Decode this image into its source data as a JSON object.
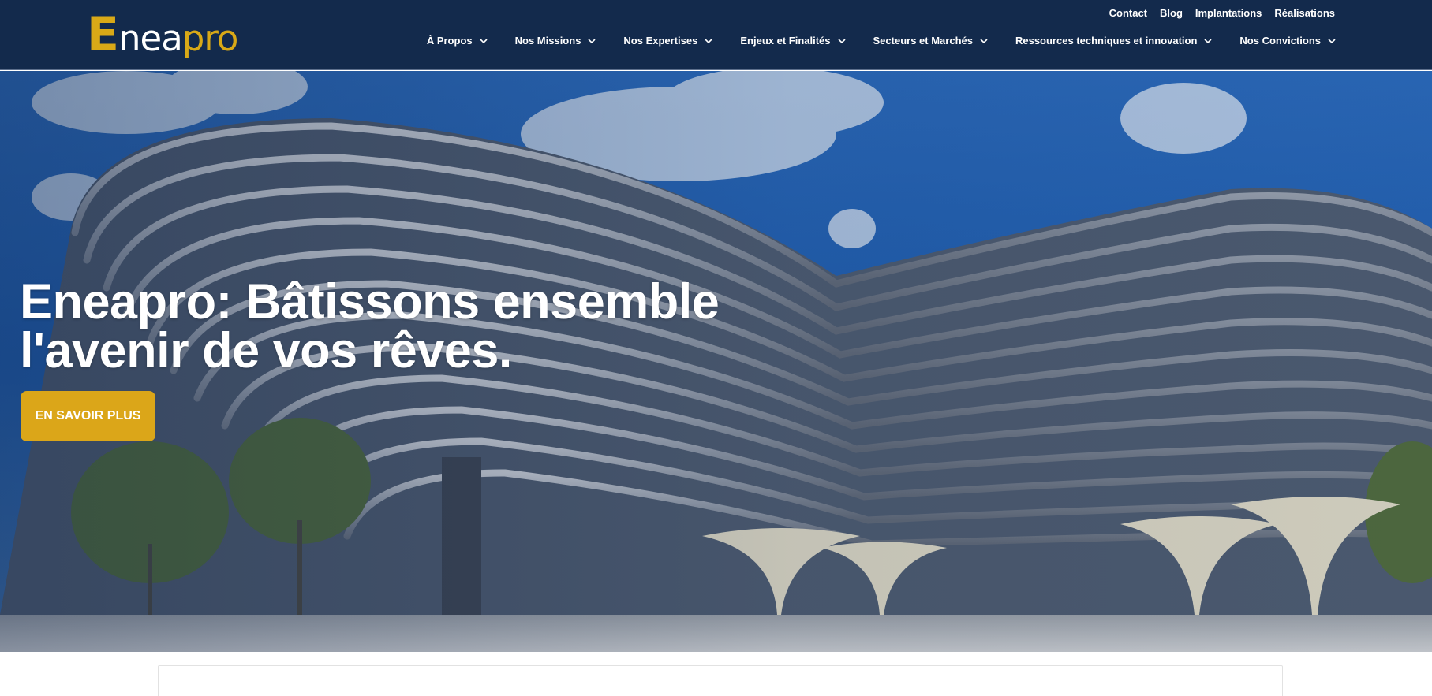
{
  "brand": {
    "logo_lead": "E",
    "logo_mid": "nea",
    "logo_tail": "pro",
    "accent_color": "#dba619",
    "header_color": "#132a4c"
  },
  "top_links": [
    "Contact",
    "Blog",
    "Implantations",
    "Réalisations"
  ],
  "nav": [
    {
      "label": "À Propos",
      "icon": "chevron-down-icon"
    },
    {
      "label": "Nos Missions",
      "icon": "chevron-down-icon"
    },
    {
      "label": "Nos Expertises",
      "icon": "chevron-down-icon"
    },
    {
      "label": "Enjeux et Finalités",
      "icon": "chevron-down-icon"
    },
    {
      "label": "Secteurs et Marchés",
      "icon": "chevron-down-icon"
    },
    {
      "label": "Ressources techniques et innovation",
      "icon": "chevron-down-icon"
    },
    {
      "label": "Nos Convictions",
      "icon": "chevron-down-icon"
    }
  ],
  "hero": {
    "title": "Eneapro: Bâtissons ensemble l'avenir de vos rêves.",
    "cta_label": "EN SAVOIR PLUS"
  }
}
